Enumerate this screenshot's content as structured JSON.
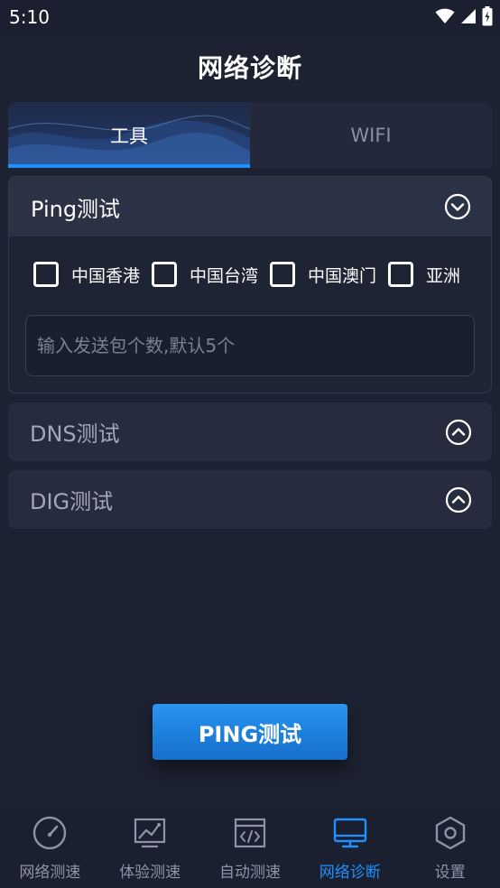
{
  "status_bar": {
    "time": "5:10",
    "icons": [
      "wifi-icon",
      "signal-icon",
      "battery-charging-icon"
    ]
  },
  "header": {
    "title": "网络诊断"
  },
  "tabs": [
    {
      "label": "工具",
      "active": true
    },
    {
      "label": "WIFI",
      "active": false
    }
  ],
  "panels": {
    "ping": {
      "title": "Ping测试",
      "expanded": true,
      "regions": [
        {
          "label": "中国香港",
          "checked": false
        },
        {
          "label": "中国台湾",
          "checked": false
        },
        {
          "label": "中国澳门",
          "checked": false
        },
        {
          "label": "亚洲",
          "checked": false
        }
      ],
      "count_input": {
        "value": "",
        "placeholder": "输入发送包个数,默认5个"
      }
    },
    "dns": {
      "title": "DNS测试",
      "expanded": false
    },
    "dig": {
      "title": "DIG测试",
      "expanded": false
    }
  },
  "action_button": {
    "label": "PING测试"
  },
  "bottom_nav": [
    {
      "label": "网络测速",
      "icon": "speedometer-icon",
      "active": false
    },
    {
      "label": "体验测速",
      "icon": "chart-line-icon",
      "active": false
    },
    {
      "label": "自动测速",
      "icon": "code-window-icon",
      "active": false
    },
    {
      "label": "网络诊断",
      "icon": "monitor-icon",
      "active": true
    },
    {
      "label": "设置",
      "icon": "hexagon-gear-icon",
      "active": false
    }
  ],
  "colors": {
    "background": "#1d2232",
    "panel": "#262b3d",
    "accent": "#1e90ff",
    "inactive_text": "#8e94a5"
  }
}
